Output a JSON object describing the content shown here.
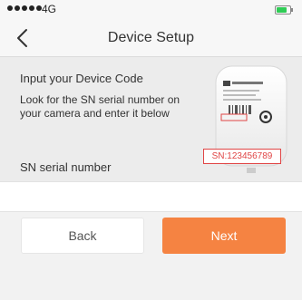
{
  "status_bar": {
    "carrier": "4G",
    "signal_dots": 5
  },
  "nav": {
    "title": "Device Setup"
  },
  "info": {
    "title": "Input your Device Code",
    "description": "Look for the SN serial number on your camera and enter it below",
    "image": {
      "sn_tag": "SN:123456789"
    }
  },
  "sn_field": {
    "label": "SN serial number",
    "value": "",
    "placeholder": ""
  },
  "buttons": {
    "back_label": "Back",
    "next_label": "Next"
  },
  "colors": {
    "accent": "#f58342",
    "sn_highlight": "#e04545",
    "battery": "#2fcc55"
  }
}
